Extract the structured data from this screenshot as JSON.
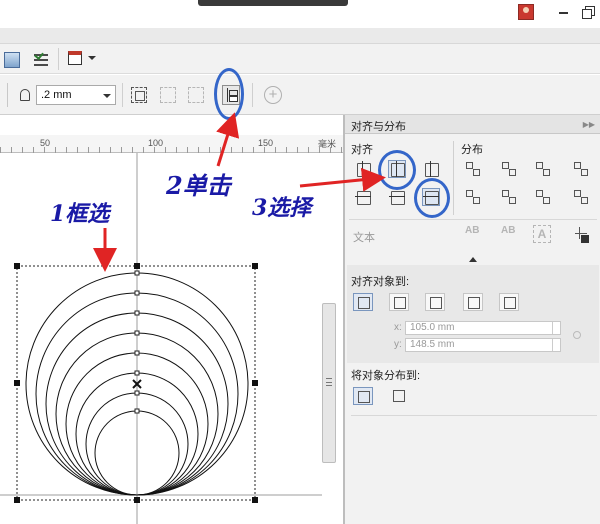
{
  "toolbar": {
    "outline_width": ".2 mm"
  },
  "ruler": {
    "labels": [
      "50",
      "100",
      "150"
    ],
    "unit": "毫米"
  },
  "docker": {
    "title": "对齐与分布",
    "align_label": "对齐",
    "distribute_label": "分布",
    "text_label": "文本",
    "align_objects_to_label": "对齐对象到:",
    "x_label": "x:",
    "x_value": "105.0 mm",
    "y_label": "y:",
    "y_value": "148.5 mm",
    "distribute_to_label": "将对象分布到:",
    "text_icon_labels": [
      "AB",
      "AB",
      "A"
    ]
  },
  "annotations": {
    "step1": "1框选",
    "step2": "2单击",
    "step3": "3选择"
  },
  "colors": {
    "annotation_text": "#1a1aa6",
    "annotation_arrow": "#e02424",
    "highlight_oval": "#3466c9"
  }
}
